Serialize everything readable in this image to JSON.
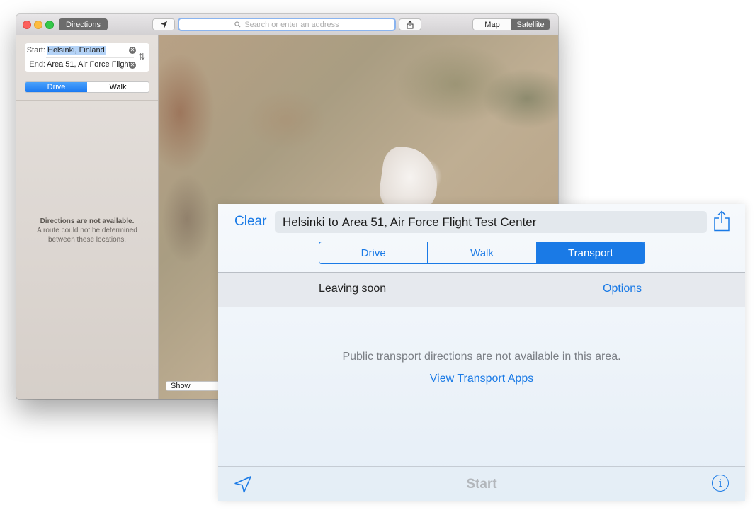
{
  "mac": {
    "directions_label": "Directions",
    "search_placeholder": "Search or enter an address",
    "map_label": "Map",
    "satellite_label": "Satellite",
    "start_label": "Start:",
    "start_value": "Helsinki, Finland",
    "end_label": "End:",
    "end_value": "Area 51, Air Force Flight",
    "modes": [
      "Drive",
      "Walk"
    ],
    "selected_mode": "Drive",
    "not_available_title": "Directions are not available.",
    "not_available_line1": "A route could not be determined",
    "not_available_line2": "between these locations.",
    "show_label": "Show"
  },
  "ios": {
    "clear_label": "Clear",
    "route_from": "Helsinki",
    "route_to_word": "to",
    "route_dest": "Area 51, Air Force Flight Test Center",
    "modes": [
      "Drive",
      "Walk",
      "Transport"
    ],
    "selected_mode": "Transport",
    "leaving_label": "Leaving soon",
    "options_label": "Options",
    "message": "Public transport directions are not available in this area.",
    "link_label": "View Transport Apps",
    "start_label": "Start",
    "info_glyph": "i"
  },
  "colors": {
    "ios_accent": "#1a7ae6",
    "mac_selected_segment": "#1a79f2"
  }
}
